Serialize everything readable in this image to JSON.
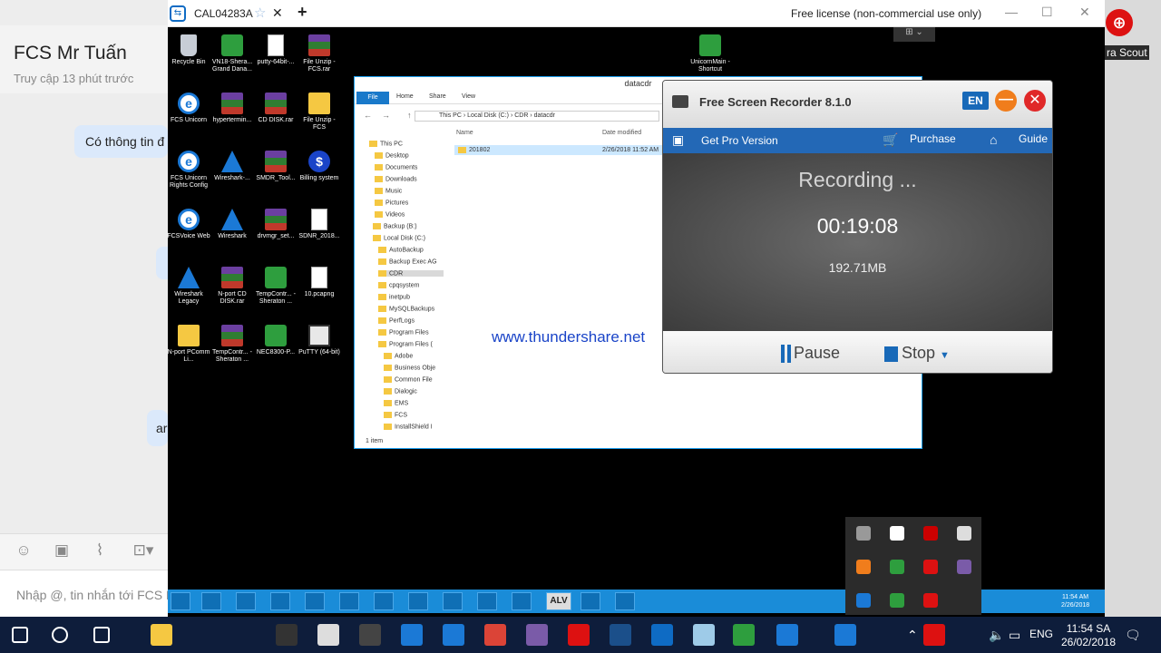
{
  "chat": {
    "title": "FCS Mr Tuấn",
    "subtitle": "Truy cập 13 phút trước",
    "bubble1": "Có thông tin đ",
    "bubble2": "ar",
    "input_placeholder": "Nhập @, tin nhắn tới FCS M"
  },
  "right_panel": {
    "scout_label": "ra Scout"
  },
  "teamviewer": {
    "tab_label": "CAL04283A",
    "license": "Free license (non-commercial use only)"
  },
  "desktop_icons": [
    {
      "label": "Recycle Bin",
      "kind": "bin"
    },
    {
      "label": "VN18-Shera... Grand Dana...",
      "kind": "green"
    },
    {
      "label": "putty-64bit-...",
      "kind": "doc"
    },
    {
      "label": "File Unzip - FCS.rar",
      "kind": "rar"
    },
    {
      "label": "FCS Unicorn",
      "kind": "ie"
    },
    {
      "label": "hypertermin...",
      "kind": "rar"
    },
    {
      "label": "CD DISK.rar",
      "kind": "rar"
    },
    {
      "label": "File Unzip - FCS",
      "kind": "fold"
    },
    {
      "label": "FCS Unicorn Rights Config",
      "kind": "ie"
    },
    {
      "label": "Wireshark-...",
      "kind": "shark"
    },
    {
      "label": "SMDR_Tool...",
      "kind": "rar"
    },
    {
      "label": "Billing system",
      "kind": "blue"
    },
    {
      "label": "FCSVoice Web",
      "kind": "ie"
    },
    {
      "label": "Wireshark",
      "kind": "shark"
    },
    {
      "label": "drvmgr_set...",
      "kind": "rar"
    },
    {
      "label": "SDNR_2018...",
      "kind": "doc"
    },
    {
      "label": "Wireshark Legacy",
      "kind": "shark"
    },
    {
      "label": "N-port CD DISK.rar",
      "kind": "rar"
    },
    {
      "label": "TempContr... - Sheraton ...",
      "kind": "green"
    },
    {
      "label": "10.pcapng",
      "kind": "doc"
    },
    {
      "label": "N-port PComm Li...",
      "kind": "fold"
    },
    {
      "label": "TempContr... - Sheraton ...",
      "kind": "rar"
    },
    {
      "label": "NEC8300-P...",
      "kind": "green"
    },
    {
      "label": "PuTTY (64-bit)",
      "kind": "putty"
    },
    {
      "label": "UnicornMain - Shortcut",
      "kind": "green"
    }
  ],
  "explorer": {
    "title": "datacdr",
    "ribbon": [
      "File",
      "Home",
      "Share",
      "View"
    ],
    "address": "This PC  ›  Local Disk (C:)  ›  CDR  ›  datacdr",
    "tree": [
      "This PC",
      "Desktop",
      "Documents",
      "Downloads",
      "Music",
      "Pictures",
      "Videos",
      "Backup (B:)",
      "Local Disk (C:)",
      "AutoBackup",
      "Backup Exec AG",
      "CDR",
      "cpqsystem",
      "inetpub",
      "MySQLBackups",
      "PerfLogs",
      "Program Files",
      "Program Files (",
      "Adobe",
      "Business Obje",
      "Common File",
      "Dialogic",
      "EMS",
      "FCS",
      "InstallShield I"
    ],
    "col_name": "Name",
    "col_date": "Date modified",
    "row_name": "201802",
    "row_date": "2/26/2018 11:52 AM",
    "status": "1 item"
  },
  "watermark": "www.thundershare.net",
  "recorder": {
    "title": "Free Screen Recorder 8.1.0",
    "lang": "EN",
    "get_pro": "Get Pro Version",
    "purchase": "Purchase",
    "guide": "Guide",
    "status": "Recording ...",
    "elapsed": "00:19:08",
    "size": "192.71MB",
    "pause": "Pause",
    "stop": "Stop"
  },
  "remote_taskbar": {
    "alv": "ALV",
    "time": "11:54 AM",
    "date": "2/26/2018"
  },
  "host_taskbar": {
    "lang": "ENG",
    "time": "11:54 SA",
    "date": "26/02/2018"
  }
}
